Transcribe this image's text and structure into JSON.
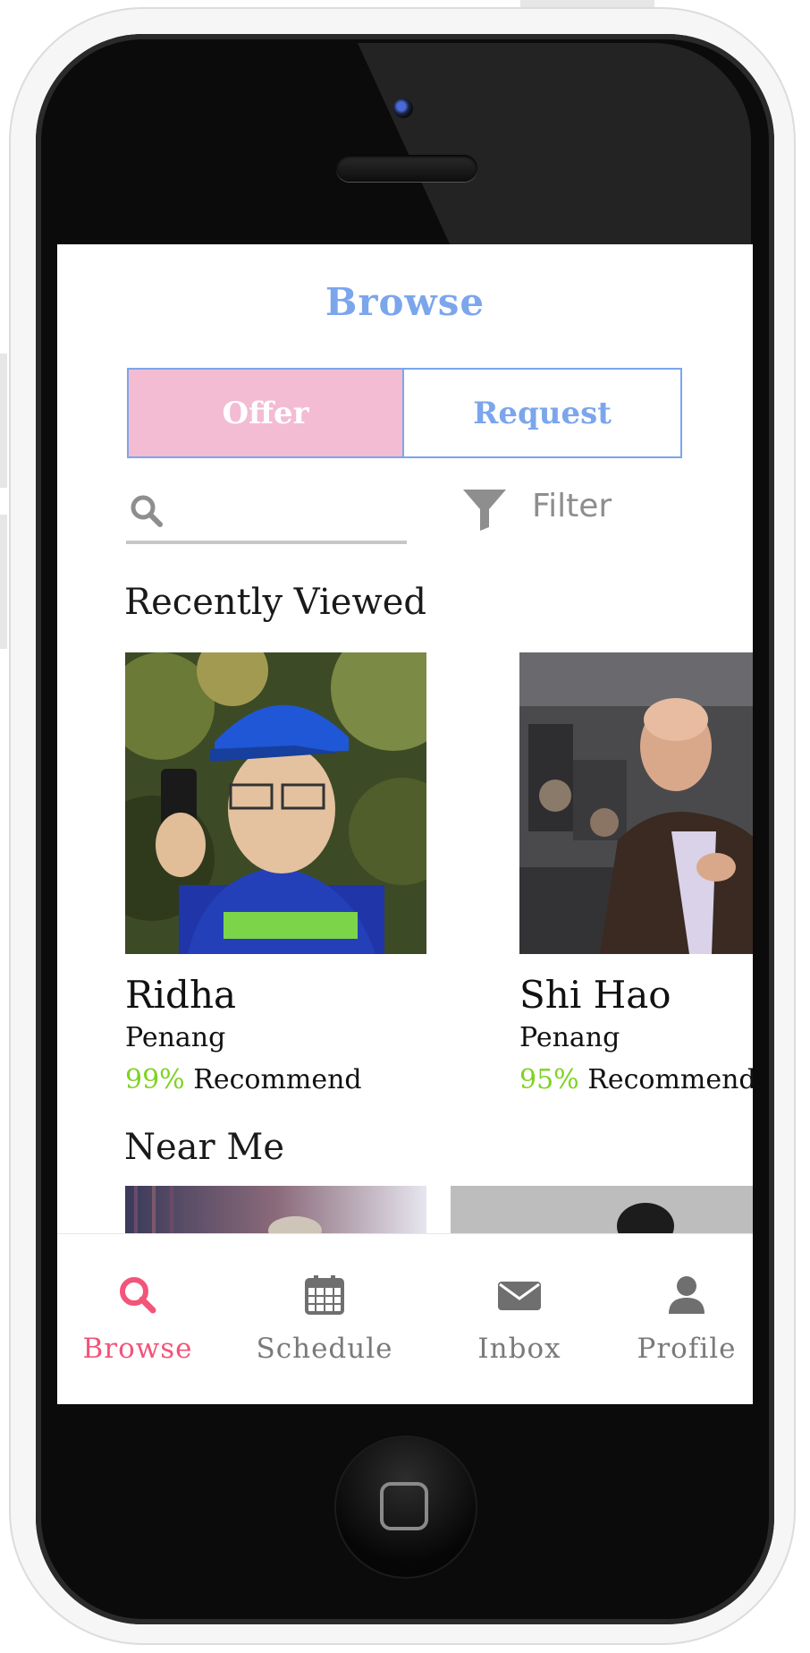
{
  "header": {
    "title": "Browse"
  },
  "segment": {
    "offer": "Offer",
    "request": "Request"
  },
  "search": {
    "placeholder": ""
  },
  "filter": {
    "label": "Filter"
  },
  "recently_viewed": {
    "title": "Recently Viewed",
    "items": [
      {
        "name": "Ridha",
        "location": "Penang",
        "percent": "99%",
        "recommend": "Recommend"
      },
      {
        "name": "Shi Hao",
        "location": "Penang",
        "percent": "95%",
        "recommend": "Recommend"
      }
    ]
  },
  "near_me": {
    "title": "Near Me"
  },
  "tabs": [
    {
      "label": "Browse",
      "icon": "search-icon",
      "active": true
    },
    {
      "label": "Schedule",
      "icon": "calendar-icon",
      "active": false
    },
    {
      "label": "Inbox",
      "icon": "mail-icon",
      "active": false
    },
    {
      "label": "Profile",
      "icon": "user-icon",
      "active": false
    }
  ],
  "colors": {
    "accent": "#7ba6ec",
    "offer_bg": "#f3bcd3",
    "active_tab": "#f2547a",
    "percent": "#7ed321"
  }
}
